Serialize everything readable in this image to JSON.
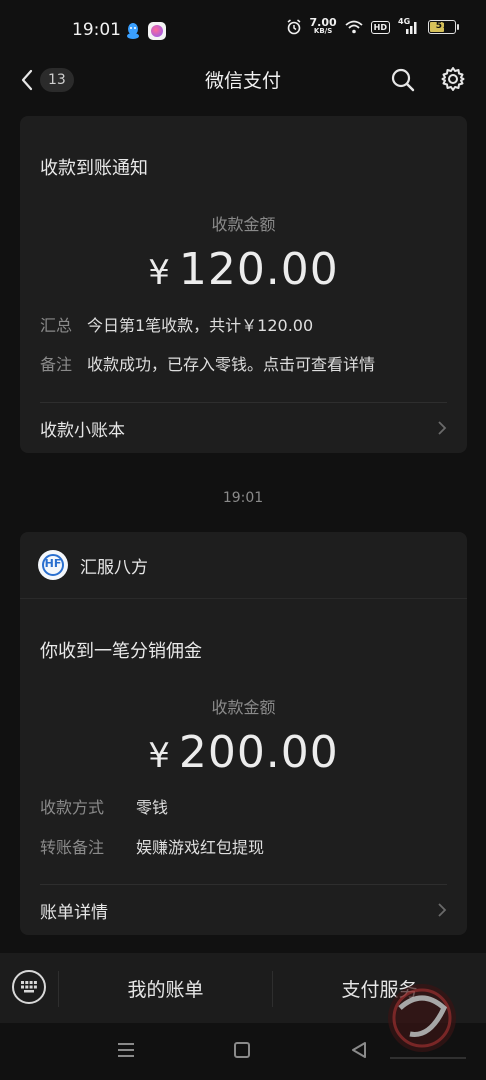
{
  "status_bar": {
    "time": "19:01",
    "net_speed": "7.00",
    "net_unit": "KB/S",
    "hd": "HD",
    "signal": "4G",
    "battery": "57"
  },
  "header": {
    "unread_count": "13",
    "title": "微信支付"
  },
  "card1": {
    "heading": "收款到账通知",
    "amount_label": "收款金额",
    "currency": "¥",
    "amount": "120.00",
    "rows": [
      {
        "key": "汇总",
        "value": "今日第1笔收款，共计￥120.00"
      },
      {
        "key": "备注",
        "value": "收款成功，已存入零钱。点击可查看详情"
      }
    ],
    "link": "收款小账本"
  },
  "timestamp": "19:01",
  "card2": {
    "merchant": "汇服八方",
    "merchant_logo_text": "HF",
    "heading": "你收到一笔分销佣金",
    "amount_label": "收款金额",
    "currency": "¥",
    "amount": "200.00",
    "rows": [
      {
        "key": "收款方式",
        "value": "零钱"
      },
      {
        "key": "转账备注",
        "value": "娱赚游戏红包提现"
      }
    ],
    "link": "账单详情"
  },
  "bottom_menu": {
    "items": [
      "我的账单",
      "支付服务"
    ]
  },
  "colors": {
    "background": "#111111",
    "card": "#1e1e1e",
    "merchant_accent": "#2a6fcf"
  }
}
